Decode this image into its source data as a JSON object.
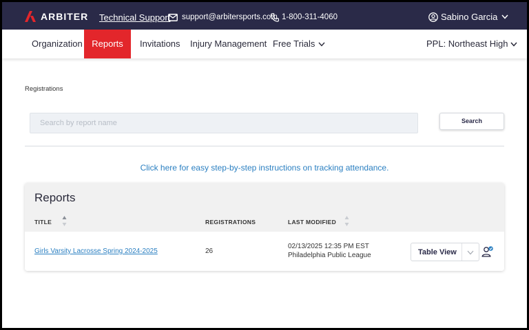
{
  "header": {
    "brand": "ARBITER",
    "support_label": "Technical Support",
    "email": "support@arbitersports.com",
    "phone": "1-800-311-4060",
    "user_name": "Sabino Garcia"
  },
  "nav": {
    "items": [
      {
        "label": "Organization"
      },
      {
        "label": "Reports",
        "active": true
      },
      {
        "label": "Invitations"
      },
      {
        "label": "Injury Management"
      },
      {
        "label": "Free Trials"
      }
    ],
    "org_selector": "PPL: Northeast High"
  },
  "breadcrumb": "Registrations",
  "search": {
    "placeholder": "Search by report name",
    "value": "",
    "button_label": "Search"
  },
  "instructions_link": "Click here for easy step-by-step instructions on tracking attendance.",
  "reports": {
    "title": "Reports",
    "columns": [
      "TITLE",
      "REGISTRATIONS",
      "LAST MODIFIED"
    ],
    "rows": [
      {
        "title": "Girls Varsity Lacrosse Spring 2024-2025",
        "registrations": "26",
        "last_modified": "02/13/2025 12:35 PM EST",
        "modified_by": "Philadelphia Public League",
        "view": "Table View"
      }
    ]
  },
  "colors": {
    "topbar": "#2a2a48",
    "active_tab": "#e3262b",
    "link": "#2a7fc1"
  }
}
